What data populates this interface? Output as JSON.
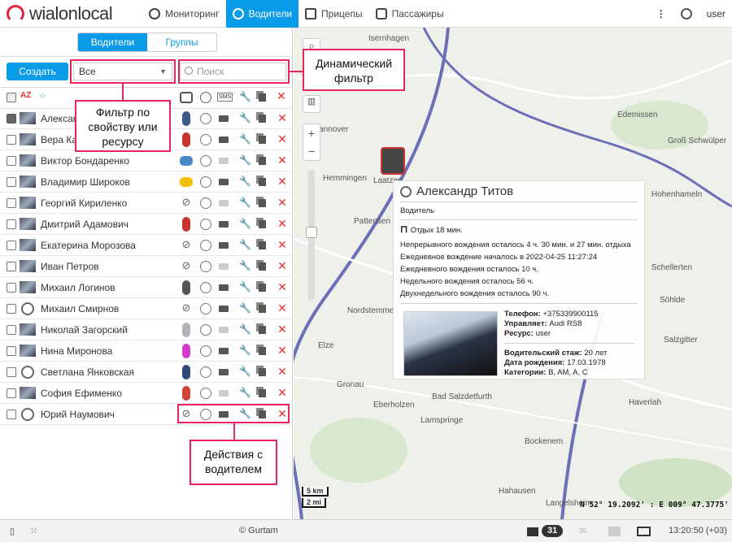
{
  "header": {
    "logo": "wialonlocal",
    "nav": [
      {
        "label": "Мониторинг",
        "icon": "globe-icon"
      },
      {
        "label": "Водители",
        "icon": "steering-wheel-icon",
        "active": true
      },
      {
        "label": "Прицепы",
        "icon": "trailer-icon"
      },
      {
        "label": "Пассажиры",
        "icon": "passenger-icon"
      }
    ],
    "user": "user"
  },
  "panel": {
    "tabs": [
      "Водители",
      "Группы"
    ],
    "create": "Создать",
    "filter_value": "Все",
    "search_placeholder": "Поиск",
    "rows": [
      {
        "name": "Александр Титов",
        "avatar": "photo",
        "unit": "car",
        "color": "#3c5a8a",
        "mail": true,
        "checked": true
      },
      {
        "name": "Вера Калинина",
        "avatar": "photo",
        "unit": "car",
        "color": "#c8332e",
        "mail": true
      },
      {
        "name": "Виктор Бондаренко",
        "avatar": "photo",
        "unit": "truck",
        "color": "#4a86c8",
        "mail": false
      },
      {
        "name": "Владимир Широков",
        "avatar": "photo",
        "unit": "taxi",
        "color": "#f2c20a",
        "mail": true
      },
      {
        "name": "Георгий Кириленко",
        "avatar": "photo",
        "unit": "unlinked",
        "mail": false
      },
      {
        "name": "Дмитрий Адамович",
        "avatar": "photo",
        "unit": "car",
        "color": "#c8332e",
        "mail": true
      },
      {
        "name": "Екатерина Морозова",
        "avatar": "photo",
        "unit": "unlinked",
        "mail": true
      },
      {
        "name": "Иван Петров",
        "avatar": "photo",
        "unit": "unlinked",
        "mail": false
      },
      {
        "name": "Михаил Логинов",
        "avatar": "photo",
        "unit": "car",
        "color": "#555555",
        "mail": true
      },
      {
        "name": "Михаил Смирнов",
        "avatar": "wheel",
        "unit": "unlinked",
        "mail": true
      },
      {
        "name": "Николай Загорский",
        "avatar": "photo",
        "unit": "car",
        "color": "#b0b4b8",
        "mail": false
      },
      {
        "name": "Нина Миронова",
        "avatar": "photo",
        "unit": "car",
        "color": "#d03cc8",
        "mail": true
      },
      {
        "name": "Светлана Янковская",
        "avatar": "wheel",
        "unit": "car",
        "color": "#2f4a7a",
        "mail": true
      },
      {
        "name": "София Ефименко",
        "avatar": "photo",
        "unit": "car",
        "color": "#d0453a",
        "mail": false
      },
      {
        "name": "Юрий Наумович",
        "avatar": "wheel",
        "unit": "unlinked",
        "mail": true
      }
    ]
  },
  "annotations": {
    "filter": "Фильтр по свойству или ресурсу",
    "dynamic": "Динамический фильтр",
    "actions": "Действия с водителем"
  },
  "popup": {
    "title": "Александр Титов",
    "type": "Водитель",
    "rest": "Отдых 18 мин.",
    "lines": [
      "Непрерывного вождения осталось 4 ч. 30 мин. и 27 мин. отдыха",
      "Ежедневное вождение началось в 2022-04-25 11:27:24",
      "Ежедневного вождения осталось 10 ч.",
      "Недельного вождения осталось 56 ч.",
      "Двухнедельного вождения осталось 90 ч."
    ],
    "phone_l": "Телефон:",
    "phone": "+375339900115",
    "drives_l": "Управляет:",
    "drives": "Audi RS8",
    "res_l": "Ресурс:",
    "res": "user",
    "exp_l": "Водительский стаж:",
    "exp": "20 лет",
    "birth_l": "Дата рождения:",
    "birth": "17.03.1978",
    "cat_l": "Категории:",
    "cat": "B, AM, A, C"
  },
  "map": {
    "labels": [
      "Isernhagen",
      "Hannover",
      "Laatzen",
      "Hemmingen",
      "Pattensen",
      "Hohenhameln",
      "Edemissen",
      "Salzgitter",
      "Nordstemmen",
      "Elze",
      "Gronau",
      "Eberholzen",
      "Bad Salzdetfurth",
      "Lamspringe",
      "Bockenem",
      "Haverlah",
      "Hahausen",
      "Langelsheim",
      "Schellerten",
      "Söhlde",
      "Groß Schwülper"
    ],
    "scale_km": "5 km",
    "scale_mi": "2 mi",
    "coords": "N 52° 19.2092' : E 009° 47.3775'"
  },
  "footer": {
    "copyright": "© Gurtam",
    "count": "31",
    "time": "13:20:50 (+03)"
  }
}
